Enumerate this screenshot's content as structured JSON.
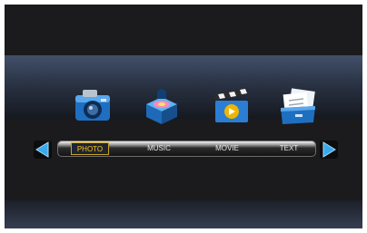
{
  "menu": {
    "items": [
      {
        "label": "PHOTO",
        "icon": "camera-icon",
        "selected": true
      },
      {
        "label": "MUSIC",
        "icon": "music-box-icon",
        "selected": false
      },
      {
        "label": "MOVIE",
        "icon": "clapperboard-icon",
        "selected": false
      },
      {
        "label": "TEXT",
        "icon": "document-folder-icon",
        "selected": false
      }
    ]
  },
  "nav": {
    "left": "left-arrow-icon",
    "right": "right-arrow-icon"
  },
  "colors": {
    "selected_text": "#ffc21a",
    "arrow": "#3aa9ea",
    "icon_blue": "#2a7fcf"
  }
}
